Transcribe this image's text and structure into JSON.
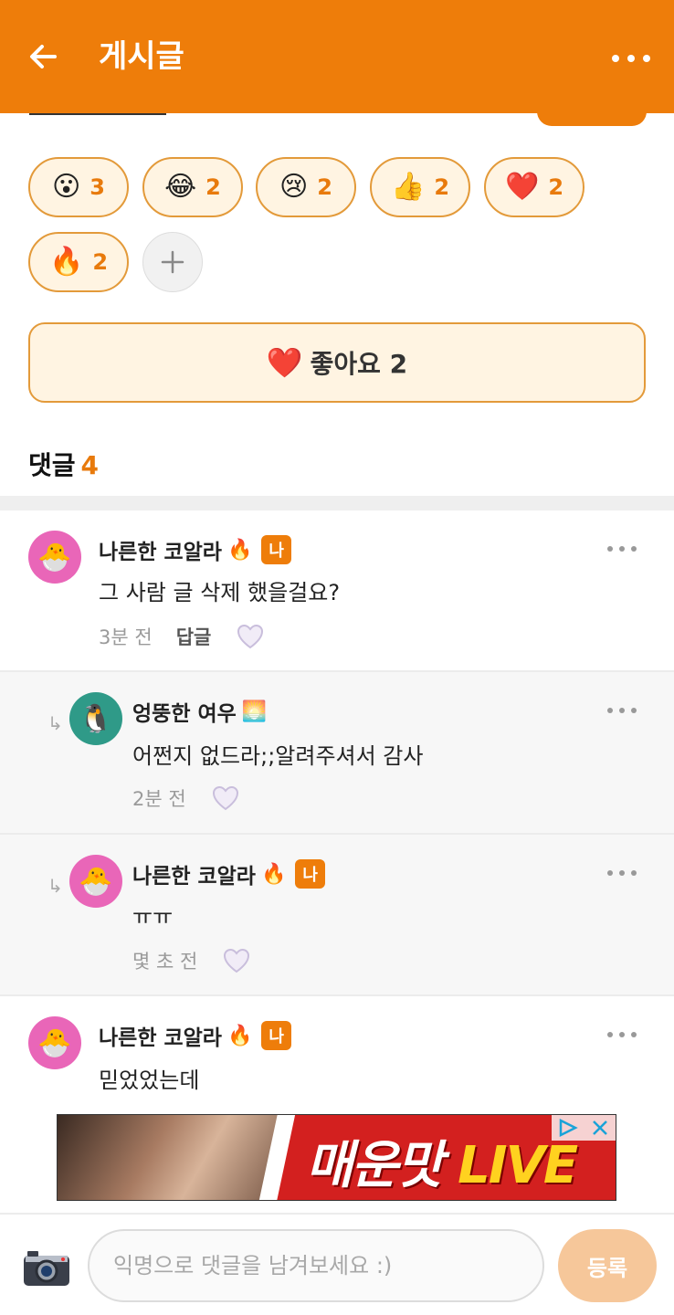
{
  "header": {
    "title": "게시글",
    "back_icon": "arrow-left-icon",
    "more_icon": "more-horizontal-icon"
  },
  "reactions": [
    {
      "emoji": "😮",
      "count": "3"
    },
    {
      "emoji": "😂",
      "count": "2"
    },
    {
      "emoji": "😢",
      "count": "2"
    },
    {
      "emoji": "👍",
      "count": "2"
    },
    {
      "emoji": "❤️",
      "count": "2"
    },
    {
      "emoji": "🔥",
      "count": "2"
    }
  ],
  "add_reaction_icon": "plus-icon",
  "like": {
    "emoji": "❤️",
    "label": "좋아요 2"
  },
  "comments_header": {
    "label": "댓글",
    "count": "4"
  },
  "comments": [
    {
      "name": "나른한 코알라",
      "badge_emoji": "🔥",
      "me": "나",
      "avatar": "🐣",
      "text": "그 사람 글 삭제 했을걸요?",
      "time": "3분 전",
      "reply": "답글"
    },
    {
      "name": "엉뚱한 여우",
      "badge_emoji": "🌅",
      "avatar": "🐧",
      "text": "어쩐지 없드라;;알려주셔서 감사",
      "time": "2분 전"
    },
    {
      "name": "나른한 코알라",
      "badge_emoji": "🔥",
      "me": "나",
      "avatar": "🐣",
      "text": "ㅠㅠ",
      "time": "몇 초 전"
    },
    {
      "name": "나른한 코알라",
      "badge_emoji": "🔥",
      "me": "나",
      "avatar": "🐣",
      "text": "믿었었는데"
    }
  ],
  "reply_arrow": "↳",
  "ad": {
    "text_main": "매운맛",
    "text_live": "LIVE"
  },
  "composer": {
    "placeholder": "익명으로 댓글을 남겨보세요 :)",
    "submit_label": "등록",
    "camera_icon": "camera-icon"
  },
  "colors": {
    "brand": "#ee7d0a",
    "reaction_bg": "#fff4e2",
    "reaction_border": "#e39a3a"
  }
}
